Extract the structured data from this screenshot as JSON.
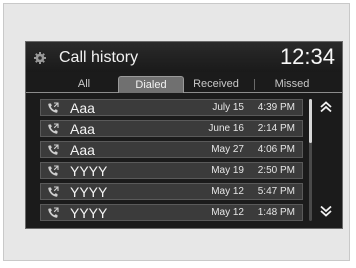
{
  "header": {
    "title": "Call history",
    "clock": "12:34",
    "icon": "gear-icon"
  },
  "tabs": [
    {
      "label": "All",
      "active": false
    },
    {
      "label": "Dialed",
      "active": true
    },
    {
      "label": "Received",
      "active": false
    },
    {
      "label": "Missed",
      "active": false
    }
  ],
  "calls": [
    {
      "icon": "outgoing-call-icon",
      "name": "Aaa",
      "date": "July 15",
      "time": "4:39 PM"
    },
    {
      "icon": "outgoing-call-icon",
      "name": "Aaa",
      "date": "June 16",
      "time": "2:14 PM"
    },
    {
      "icon": "outgoing-call-icon",
      "name": "Aaa",
      "date": "May 27",
      "time": "4:06 PM"
    },
    {
      "icon": "outgoing-call-icon",
      "name": "YYYY",
      "date": "May 19",
      "time": "2:50 PM"
    },
    {
      "icon": "outgoing-call-icon",
      "name": "YYYY",
      "date": "May 12",
      "time": "5:47 PM"
    },
    {
      "icon": "outgoing-call-icon",
      "name": "YYYY",
      "date": "May 12",
      "time": "1:48 PM"
    }
  ],
  "scroll": {
    "up_icon": "double-chevron-up-icon",
    "down_icon": "double-chevron-down-icon"
  },
  "colors": {
    "screen_bg": "#1b1b1b",
    "row_bg": "#3b3b3b",
    "active_tab_bg": "#707070",
    "text": "#f4f4f4"
  }
}
